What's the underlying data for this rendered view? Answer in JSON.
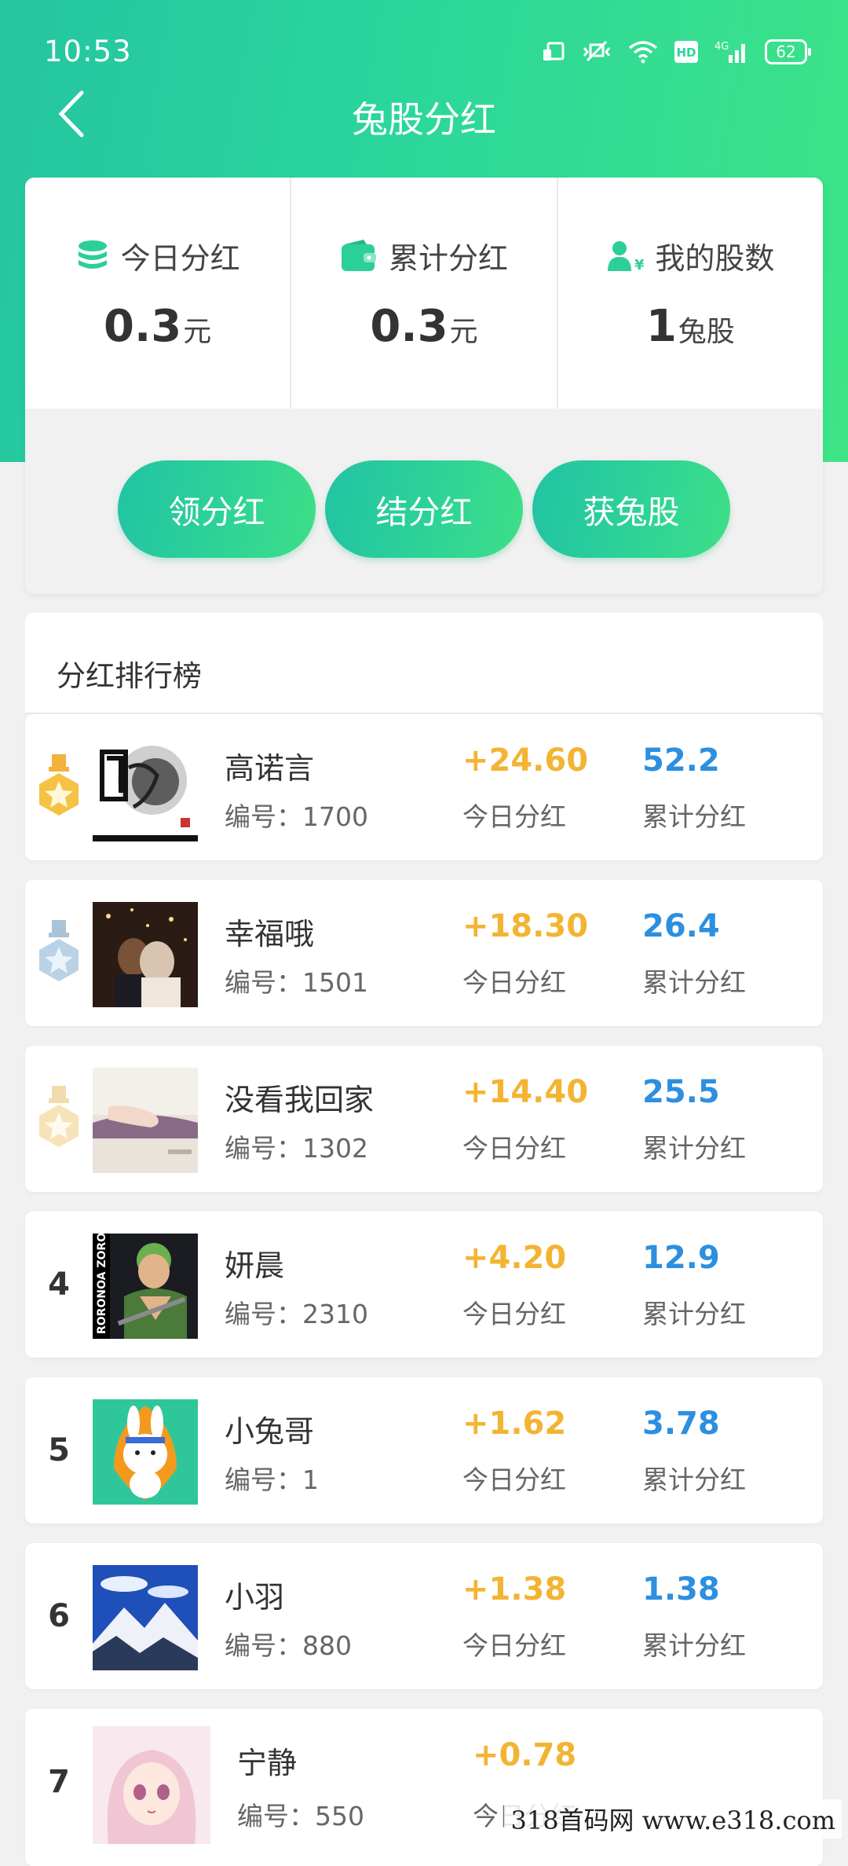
{
  "status": {
    "time": "10:53",
    "battery": "62"
  },
  "header": {
    "title": "兔股分红"
  },
  "summary": {
    "today": {
      "label": "今日分红",
      "value": "0.3",
      "unit": "元"
    },
    "total": {
      "label": "累计分红",
      "value": "0.3",
      "unit": "元"
    },
    "shares": {
      "label": "我的股数",
      "value": "1",
      "unit": "兔股"
    }
  },
  "actions": {
    "claim": "领分红",
    "settle": "结分红",
    "get_shares": "获兔股"
  },
  "board": {
    "title": "分红排行榜",
    "today_label": "今日分红",
    "total_label": "累计分红",
    "rows": [
      {
        "rank": "1",
        "medal": "gold-medal-icon",
        "name": "高诺言",
        "uid": "编号：1700",
        "today": "+24.60",
        "total": "52.2",
        "avatar": "ink-calligraphy-avatar"
      },
      {
        "rank": "2",
        "medal": "silver-medal-icon",
        "name": "幸福哦",
        "uid": "编号：1501",
        "today": "+18.30",
        "total": "26.4",
        "avatar": "couple-night-avatar"
      },
      {
        "rank": "3",
        "medal": "bronze-medal-icon",
        "name": "没看我回家",
        "uid": "编号：1302",
        "today": "+14.40",
        "total": "25.5",
        "avatar": "hand-on-bench-avatar"
      },
      {
        "rank": "4",
        "name": "妍晨",
        "uid": "编号：2310",
        "today": "+4.20",
        "total": "12.9",
        "avatar": "anime-swordsman-avatar",
        "avatar_text": "RORONOA ZORO"
      },
      {
        "rank": "5",
        "name": "小兔哥",
        "uid": "编号：1",
        "today": "+1.62",
        "total": "3.78",
        "avatar": "bunny-mascot-avatar"
      },
      {
        "rank": "6",
        "name": "小羽",
        "uid": "编号：880",
        "today": "+1.38",
        "total": "1.38",
        "avatar": "snow-mountain-avatar"
      },
      {
        "rank": "7",
        "name": "宁静",
        "uid": "编号：550",
        "today": "+0.78",
        "total": "",
        "avatar": "anime-girl-avatar"
      }
    ]
  },
  "watermark": "318首码网 www.e318.com",
  "colors": {
    "accent": "#2bd69b",
    "today_value": "#f3b433",
    "total_value": "#2c8fe0"
  }
}
